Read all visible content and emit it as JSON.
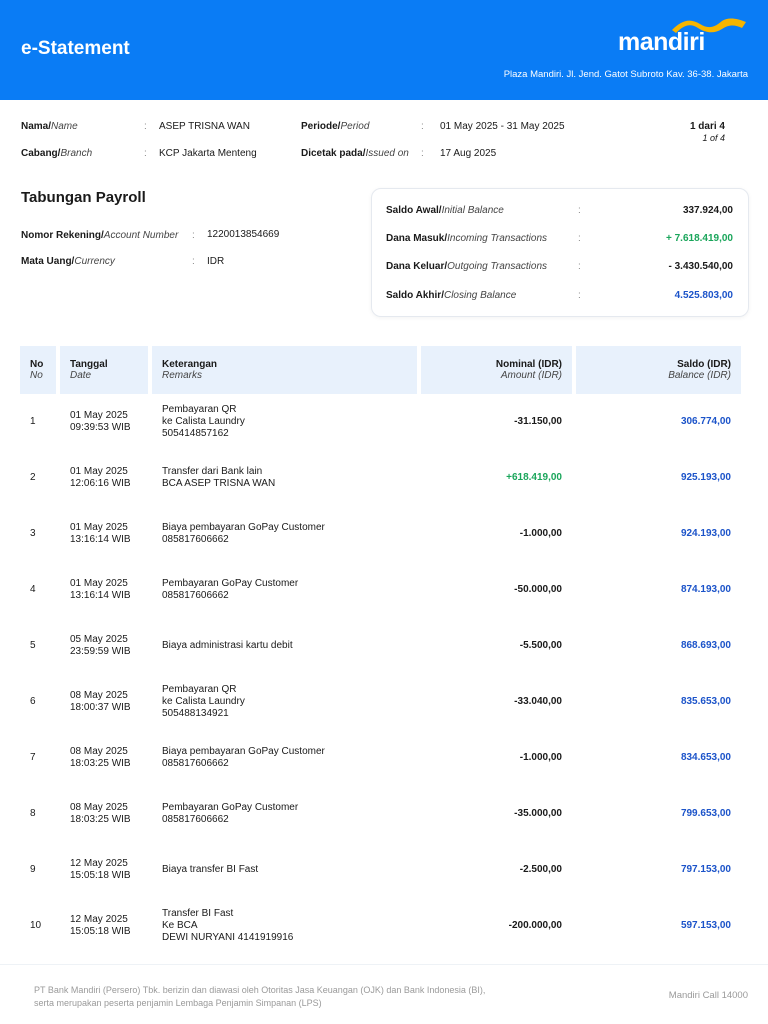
{
  "header": {
    "title": "e-Statement",
    "logo_text": "mandiri",
    "address": "Plaza Mandiri. Jl. Jend. Gatot Subroto Kav. 36-38. Jakarta",
    "brand_color": "#0a7cf5",
    "accent_color": "#f7b500"
  },
  "info": {
    "name_label": "Nama/",
    "name_label_en": "Name",
    "name": "ASEP TRISNA WAN",
    "branch_label": "Cabang/",
    "branch_label_en": "Branch",
    "branch": "KCP Jakarta Menteng",
    "period_label": "Periode/",
    "period_label_en": "Period",
    "period": "01 May 2025 - 31 May 2025",
    "issued_label": "Dicetak pada/",
    "issued_label_en": "Issued on",
    "issued": "17 Aug 2025",
    "page": "1 dari 4",
    "page_en": "1 of 4"
  },
  "account": {
    "title": "Tabungan Payroll",
    "number_label": "Nomor Rekening/",
    "number_label_en": "Account Number",
    "number": "1220013854669",
    "currency_label": "Mata Uang/",
    "currency_label_en": "Currency",
    "currency": "IDR"
  },
  "summary": [
    {
      "label": "Saldo Awal/",
      "label_en": "Initial Balance",
      "value": "337.924,00"
    },
    {
      "label": "Dana Masuk/",
      "label_en": "Incoming Transactions",
      "value": "+ 7.618.419,00"
    },
    {
      "label": "Dana Keluar/",
      "label_en": "Outgoing Transactions",
      "value": "- 3.430.540,00"
    },
    {
      "label": "Saldo Akhir/",
      "label_en": "Closing Balance",
      "value": "4.525.803,00"
    }
  ],
  "table": {
    "headers": [
      {
        "label": "No",
        "label_en": "No"
      },
      {
        "label": "Tanggal",
        "label_en": "Date"
      },
      {
        "label": "Keterangan",
        "label_en": "Remarks"
      },
      {
        "label": "Nominal (IDR)",
        "label_en": "Amount (IDR)"
      },
      {
        "label": "Saldo (IDR)",
        "label_en": "Balance (IDR)"
      }
    ],
    "rows": [
      {
        "no": "1",
        "date": "01 May 2025",
        "time": "09:39:53 WIB",
        "remarks": [
          "Pembayaran QR",
          "ke Calista Laundry",
          "505414857162"
        ],
        "amount": "-31.150,00",
        "balance": "306.774,00"
      },
      {
        "no": "2",
        "date": "01 May 2025",
        "time": "12:06:16 WIB",
        "remarks": [
          "Transfer dari Bank lain",
          "BCA ASEP TRISNA WAN"
        ],
        "amount": "+618.419,00",
        "balance": "925.193,00"
      },
      {
        "no": "3",
        "date": "01 May 2025",
        "time": "13:16:14 WIB",
        "remarks": [
          "Biaya pembayaran GoPay Customer",
          "085817606662"
        ],
        "amount": "-1.000,00",
        "balance": "924.193,00"
      },
      {
        "no": "4",
        "date": "01 May 2025",
        "time": "13:16:14 WIB",
        "remarks": [
          "Pembayaran GoPay Customer",
          "085817606662"
        ],
        "amount": "-50.000,00",
        "balance": "874.193,00"
      },
      {
        "no": "5",
        "date": "05 May 2025",
        "time": "23:59:59 WIB",
        "remarks": [
          "Biaya administrasi kartu debit"
        ],
        "amount": "-5.500,00",
        "balance": "868.693,00"
      },
      {
        "no": "6",
        "date": "08 May 2025",
        "time": "18:00:37 WIB",
        "remarks": [
          "Pembayaran QR",
          "ke Calista Laundry",
          "505488134921"
        ],
        "amount": "-33.040,00",
        "balance": "835.653,00"
      },
      {
        "no": "7",
        "date": "08 May 2025",
        "time": "18:03:25 WIB",
        "remarks": [
          "Biaya pembayaran GoPay Customer",
          "085817606662"
        ],
        "amount": "-1.000,00",
        "balance": "834.653,00"
      },
      {
        "no": "8",
        "date": "08 May 2025",
        "time": "18:03:25 WIB",
        "remarks": [
          "Pembayaran GoPay Customer",
          "085817606662"
        ],
        "amount": "-35.000,00",
        "balance": "799.653,00"
      },
      {
        "no": "9",
        "date": "12 May 2025",
        "time": "15:05:18 WIB",
        "remarks": [
          "Biaya transfer BI Fast"
        ],
        "amount": "-2.500,00",
        "balance": "797.153,00"
      },
      {
        "no": "10",
        "date": "12 May 2025",
        "time": "15:05:18 WIB",
        "remarks": [
          "Transfer BI Fast",
          "Ke BCA",
          "DEWI NURYANI 4141919916"
        ],
        "amount": "-200.000,00",
        "balance": "597.153,00"
      }
    ]
  },
  "footer": {
    "disclaimer_1": "PT Bank Mandiri (Persero) Tbk. berizin dan diawasi oleh Otoritas Jasa Keuangan (OJK) dan Bank Indonesia (BI),",
    "disclaimer_2": "serta merupakan peserta penjamin Lembaga Penjamin Simpanan (LPS)",
    "call": "Mandiri Call 14000"
  }
}
